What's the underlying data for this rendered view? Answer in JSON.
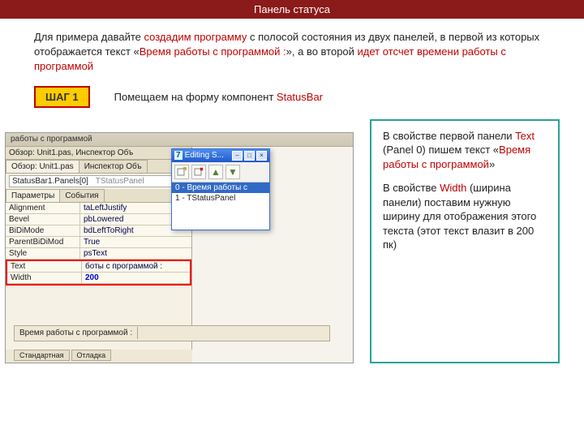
{
  "header": {
    "title": "Панель статуса"
  },
  "intro": {
    "t1": " Для примера давайте ",
    "t2": "создадим программу",
    "t3": " с полосой состояния из двух панелей, в первой из которых отображается текст «",
    "t4": "Время работы с программой :",
    "t5": "», а во второй ",
    "t6": "идет отсчет времени работы с программой"
  },
  "step": {
    "badge": "ШАГ 1",
    "text": "Помещаем на форму компонент ",
    "comp": "StatusBar"
  },
  "shot": {
    "appTitle": "работы с программой",
    "inspTitle": "Обзор: Unit1.pas, Инспектор Объ",
    "tabObzor": "Обзор: Unit1.pas",
    "tabInsp": "Инспектор Объ",
    "selectVal": "StatusBar1.Panels[0]",
    "selectType": "TStatusPanel",
    "tabProps": "Параметры",
    "tabEvents": "События",
    "props": [
      {
        "k": "Alignment",
        "v": "taLeftJustify"
      },
      {
        "k": "Bevel",
        "v": "pbLowered"
      },
      {
        "k": "BiDiMode",
        "v": "bdLeftToRight"
      },
      {
        "k": "ParentBiDiMod",
        "v": "True"
      },
      {
        "k": "Style",
        "v": "psText"
      }
    ],
    "propsHi": [
      {
        "k": "Text",
        "v": "боты с программой :"
      },
      {
        "k": "Width",
        "v": "200"
      }
    ],
    "statusText": "Время работы с программой :",
    "bottomA": "Стандартная",
    "bottomB": "Отладка"
  },
  "popup": {
    "title": "Editing S...",
    "titleIcon": "7",
    "item0": "0 - Время работы с",
    "item1": "1 - TStatusPanel"
  },
  "explain": {
    "p1a": " В свойстве первой панели ",
    "p1b": "Text",
    "p1c": " (Panel 0) пишем текст «",
    "p1d": "Время работы с программой",
    "p1e": "»",
    "p2a": " В свойстве ",
    "p2b": "Width",
    "p2c": " (ширина панели) поставим нужную ширину для отображения этого текста (этот текст влазит в 200 пк)"
  }
}
